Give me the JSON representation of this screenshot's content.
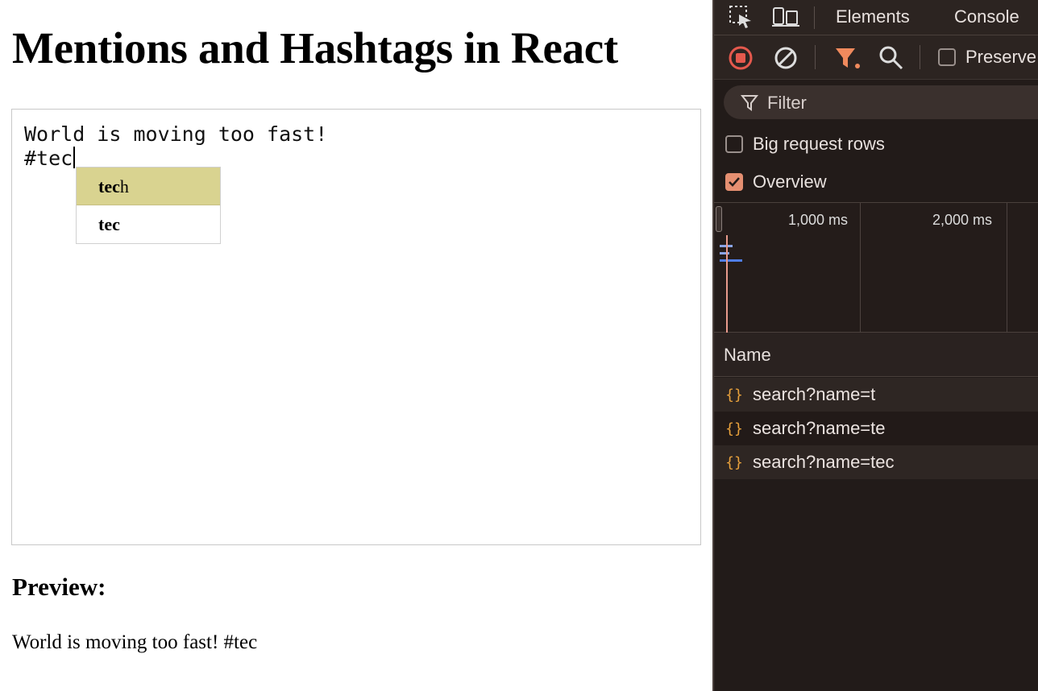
{
  "page": {
    "title": "Mentions and Hashtags in React",
    "editor": {
      "line1": "World is moving too fast!",
      "line2": "#tec"
    },
    "suggestions": [
      {
        "match": "tec",
        "rest": "h",
        "active": true
      },
      {
        "match": "tec",
        "rest": "",
        "active": false
      }
    ],
    "preview": {
      "heading": "Preview:",
      "text": "World is moving too fast! #tec"
    }
  },
  "devtools": {
    "tabs": [
      "Elements",
      "Console"
    ],
    "toolbar": {
      "preserve_label": "Preserve"
    },
    "filter": {
      "placeholder": "Filter"
    },
    "options": [
      {
        "label": "Big request rows",
        "checked": false
      },
      {
        "label": "Overview",
        "checked": true
      }
    ],
    "overview": {
      "ticks": [
        "1,000 ms",
        "2,000 ms"
      ]
    },
    "table": {
      "name_header": "Name",
      "requests": [
        "search?name=t",
        "search?name=te",
        "search?name=tec"
      ]
    },
    "colors": {
      "accent": "#e58f71",
      "record": "#e5594d",
      "filter_active": "#f08a5d",
      "request_icon": "#e8a13c"
    }
  }
}
